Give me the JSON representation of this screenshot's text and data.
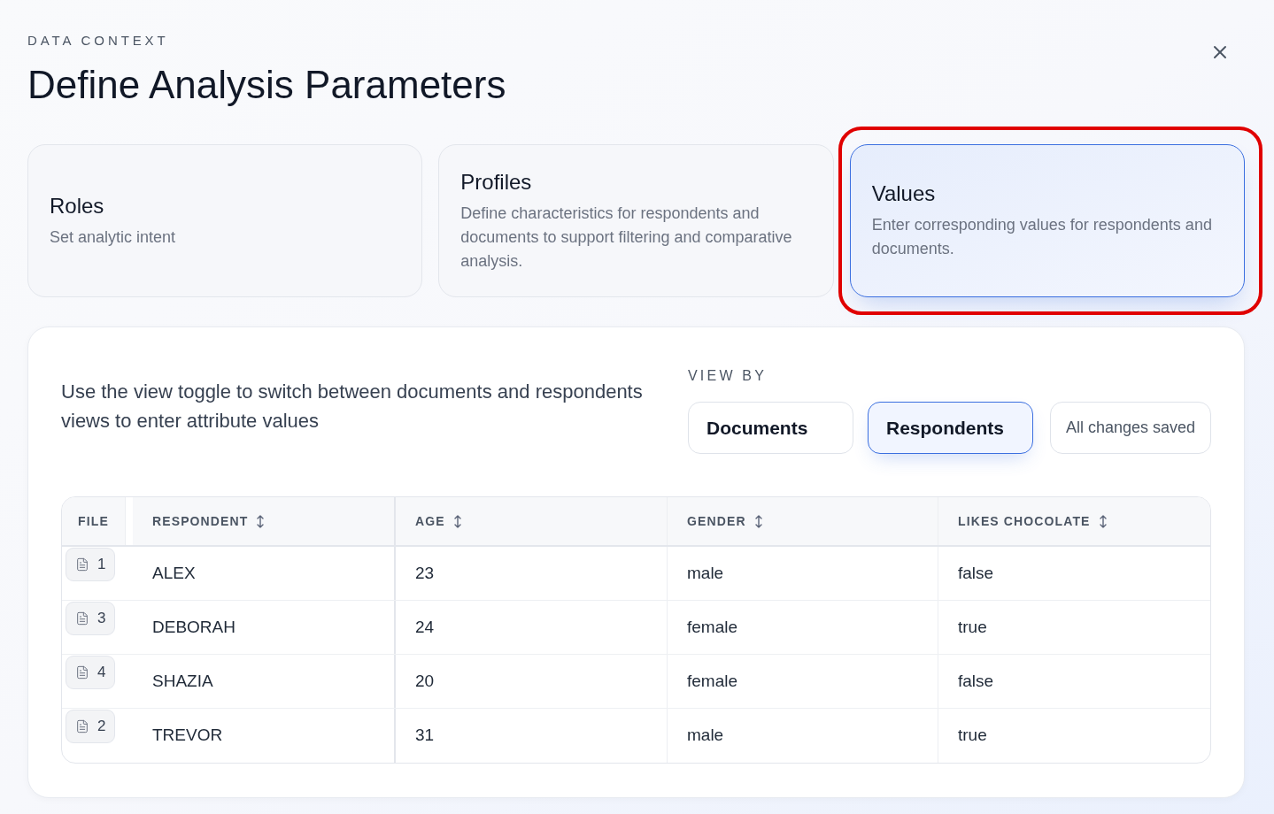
{
  "header": {
    "eyebrow": "DATA CONTEXT",
    "title": "Define Analysis Parameters"
  },
  "steps": [
    {
      "title": "Roles",
      "description": "Set analytic intent",
      "selected": false,
      "highlighted": false
    },
    {
      "title": "Profiles",
      "description": "Define characteristics for respondents and documents to support filtering and comparative analysis.",
      "selected": false,
      "highlighted": false
    },
    {
      "title": "Values",
      "description": "Enter corresponding values for respondents and documents.",
      "selected": true,
      "highlighted": true
    }
  ],
  "panel": {
    "instructions": "Use the view toggle to switch between documents and respondents views to enter attribute values",
    "view_by": {
      "label": "VIEW BY",
      "options": [
        {
          "label": "Documents",
          "selected": false
        },
        {
          "label": "Respondents",
          "selected": true
        }
      ]
    },
    "save_status": "All changes saved"
  },
  "table": {
    "columns": [
      {
        "label": "FILE",
        "sortable": false
      },
      {
        "label": "RESPONDENT",
        "sortable": true
      },
      {
        "label": "AGE",
        "sortable": true
      },
      {
        "label": "GENDER",
        "sortable": true
      },
      {
        "label": "LIKES CHOCOLATE",
        "sortable": true
      }
    ],
    "rows": [
      {
        "cells": [
          "1",
          "ALEX",
          "23",
          "male",
          "false"
        ]
      },
      {
        "cells": [
          "3",
          "DEBORAH",
          "24",
          "female",
          "true"
        ]
      },
      {
        "cells": [
          "4",
          "SHAZIA",
          "20",
          "female",
          "false"
        ]
      },
      {
        "cells": [
          "2",
          "TREVOR",
          "31",
          "male",
          "true"
        ]
      }
    ]
  }
}
